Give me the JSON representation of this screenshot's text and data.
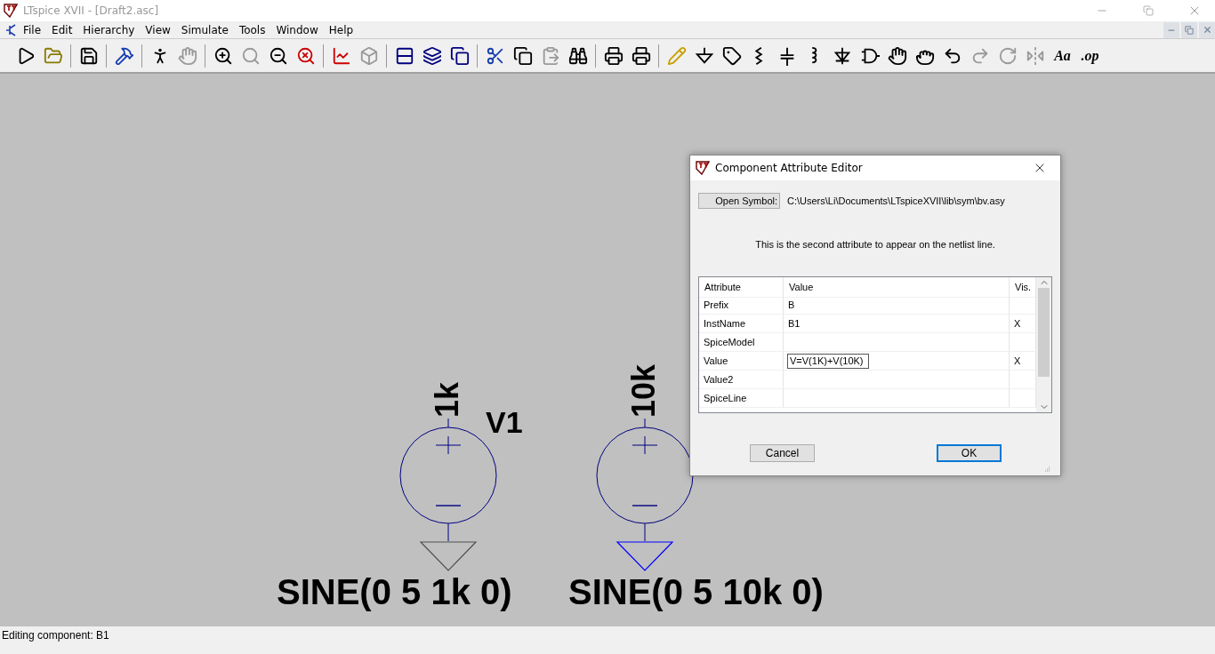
{
  "window": {
    "title": "LTspice XVII - [Draft2.asc]"
  },
  "menu": [
    "File",
    "Edit",
    "Hierarchy",
    "View",
    "Simulate",
    "Tools",
    "Window",
    "Help"
  ],
  "toolbar": {
    "text_buttons": [
      "Aa",
      ".op"
    ]
  },
  "schematic": {
    "components": [
      {
        "value": "1k",
        "name": "V1",
        "source": "SINE(0 5 1k 0)",
        "color": "#505050"
      },
      {
        "value": "10k",
        "source": "SINE(0 5 10k 0)",
        "color": "#0000ff"
      }
    ]
  },
  "dialog": {
    "title": "Component Attribute Editor",
    "open_symbol_button": "Open Symbol:",
    "path": "C:\\Users\\Li\\Documents\\LTspiceXVII\\lib\\sym\\bv.asy",
    "description": "This is the second attribute to appear on the netlist line.",
    "columns": [
      "Attribute",
      "Value",
      "Vis."
    ],
    "rows": [
      {
        "attribute": "Prefix",
        "value": "B",
        "editing": false
      },
      {
        "attribute": "InstName",
        "value": "B1",
        "vis": "X",
        "editing": false
      },
      {
        "attribute": "SpiceModel",
        "editing": false
      },
      {
        "attribute": "Value",
        "value": "V=V(1K)+V(10K)",
        "vis": "X",
        "editing": true
      },
      {
        "attribute": "Value2",
        "editing": false
      },
      {
        "attribute": "SpiceLine",
        "editing": false
      }
    ],
    "buttons": [
      {
        "label": "Cancel",
        "default": false
      },
      {
        "label": "OK",
        "default": true
      }
    ]
  },
  "status_bar": "Editing component: B1"
}
